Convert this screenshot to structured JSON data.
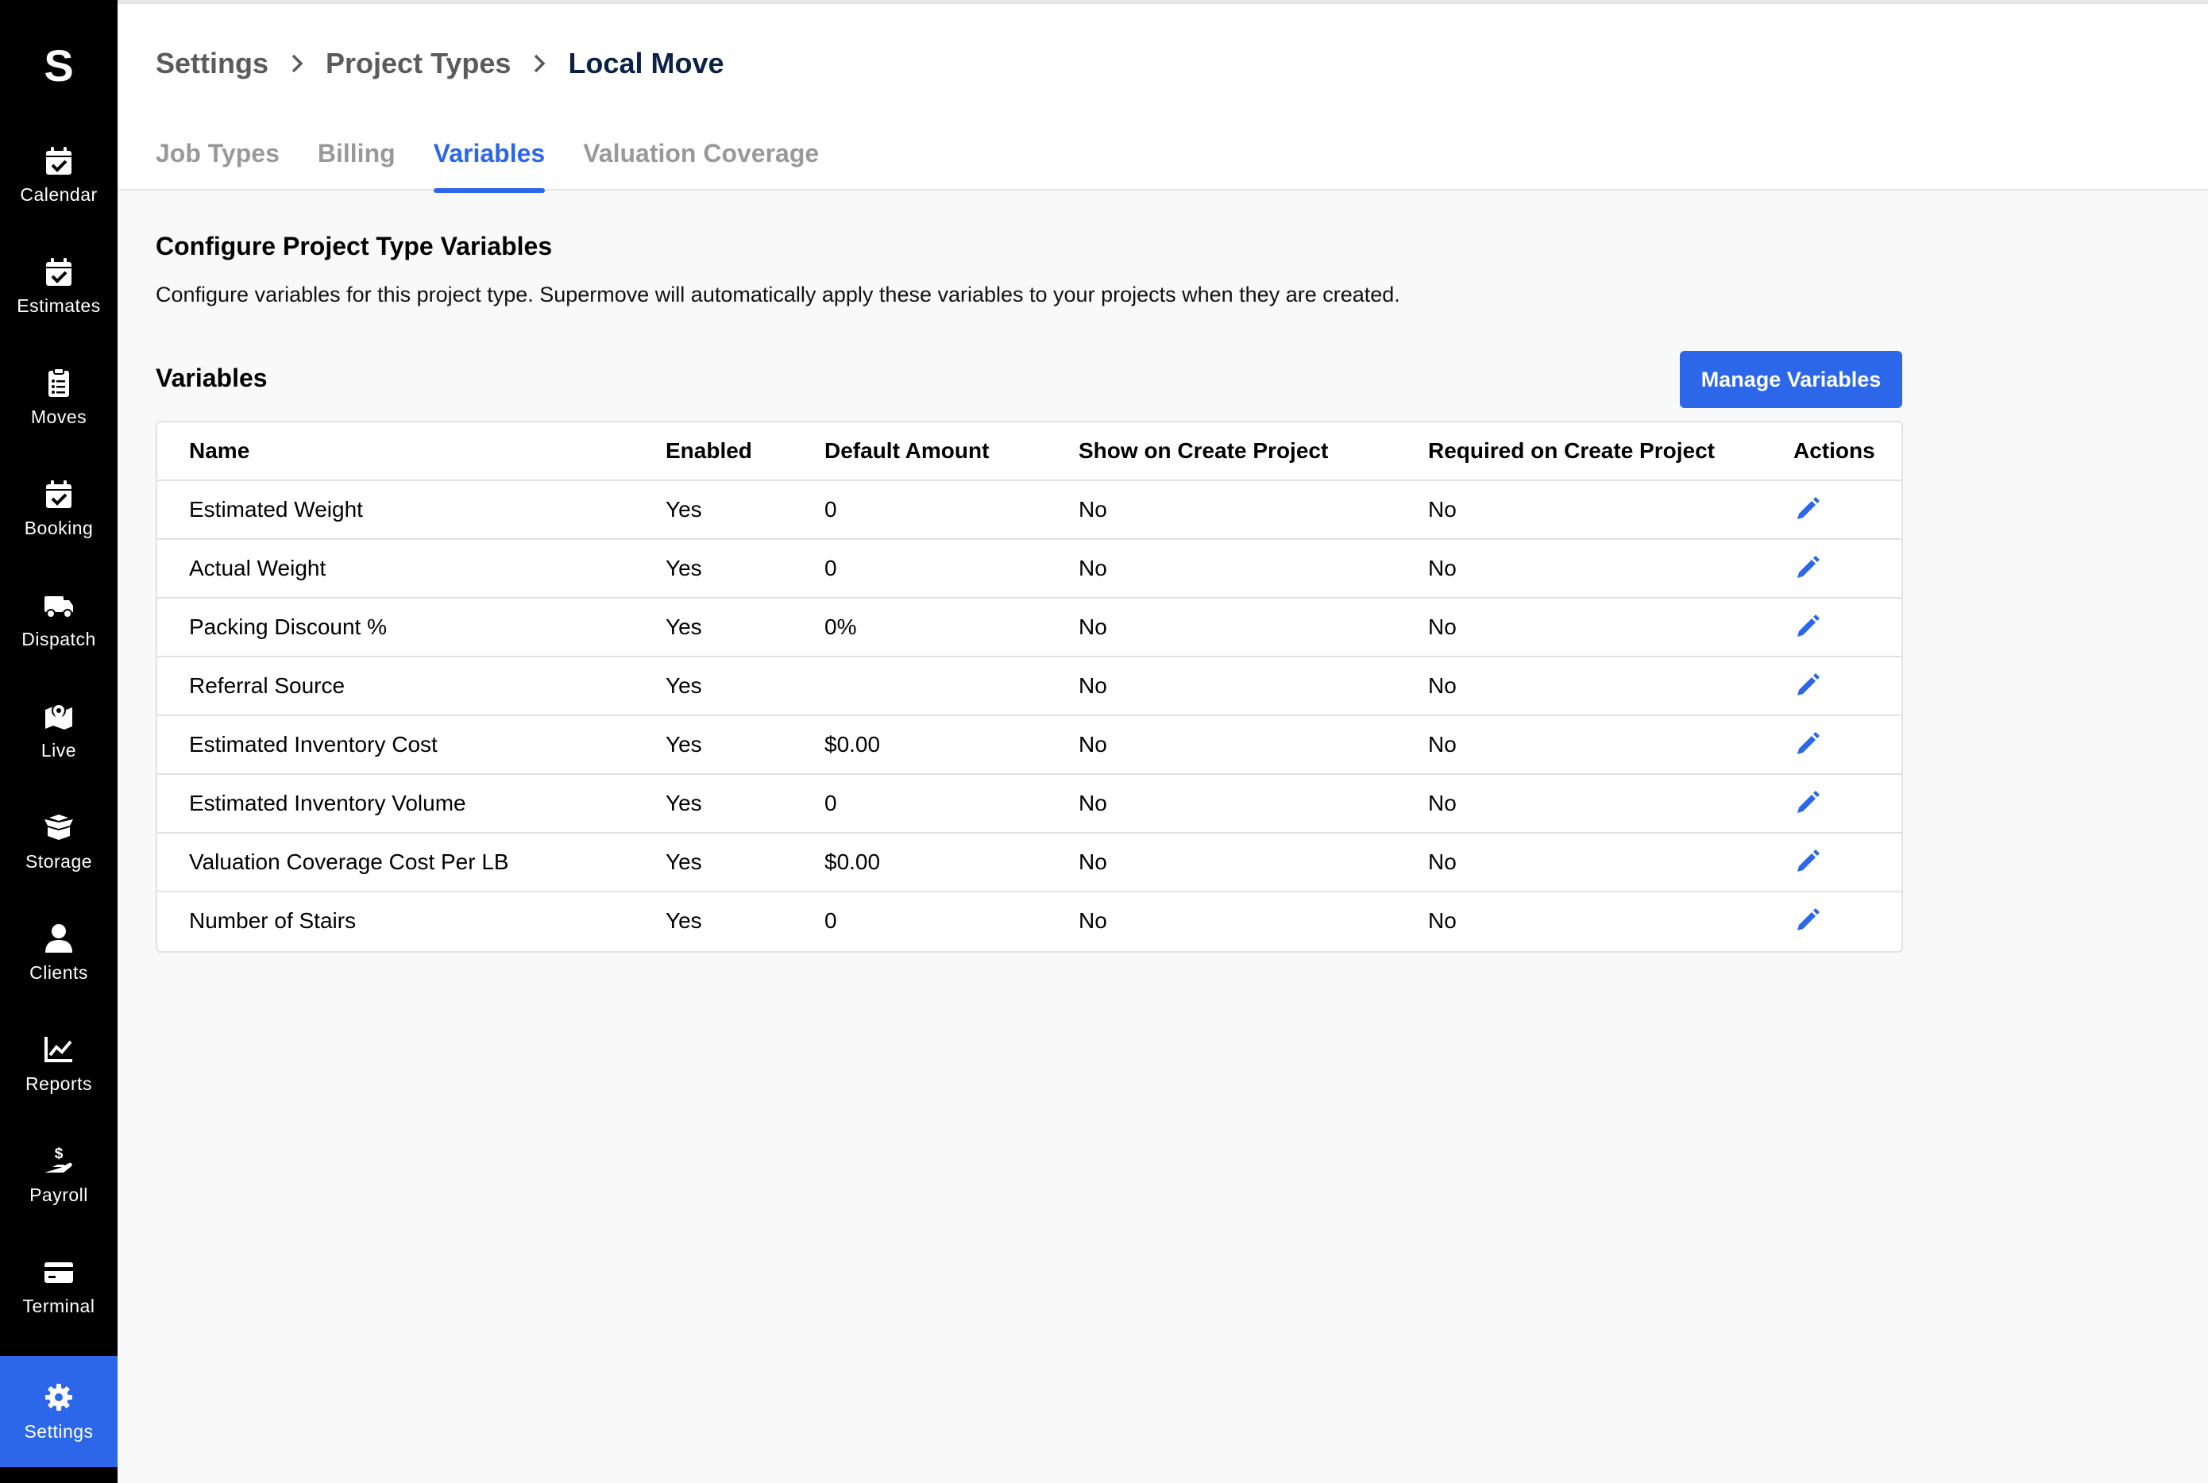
{
  "sidebar": {
    "logo": "S",
    "items": [
      {
        "label": "Calendar",
        "icon": "calendar-check-icon"
      },
      {
        "label": "Estimates",
        "icon": "calendar-check-icon"
      },
      {
        "label": "Moves",
        "icon": "clipboard-list-icon"
      },
      {
        "label": "Booking",
        "icon": "calendar-check-icon"
      },
      {
        "label": "Dispatch",
        "icon": "truck-icon"
      },
      {
        "label": "Live",
        "icon": "map-marker-icon"
      },
      {
        "label": "Storage",
        "icon": "box-open-icon"
      },
      {
        "label": "Clients",
        "icon": "user-icon"
      },
      {
        "label": "Reports",
        "icon": "chart-line-icon"
      },
      {
        "label": "Payroll",
        "icon": "hand-dollar-icon"
      },
      {
        "label": "Terminal",
        "icon": "credit-card-icon"
      },
      {
        "label": "Settings",
        "icon": "gear-icon",
        "active": true
      }
    ]
  },
  "breadcrumb": {
    "items": [
      "Settings",
      "Project Types",
      "Local Move"
    ]
  },
  "tabs": [
    {
      "label": "Job Types"
    },
    {
      "label": "Billing"
    },
    {
      "label": "Variables",
      "active": true
    },
    {
      "label": "Valuation Coverage"
    }
  ],
  "main": {
    "title": "Configure Project Type Variables",
    "description": "Configure variables for this project type. Supermove will automatically apply these variables to your projects when they are created.",
    "variables_title": "Variables",
    "manage_button": "Manage Variables"
  },
  "table": {
    "headers": [
      "Name",
      "Enabled",
      "Default Amount",
      "Show on Create Project",
      "Required on Create Project",
      "Actions"
    ],
    "rows": [
      {
        "name": "Estimated Weight",
        "enabled": "Yes",
        "default": "0",
        "show": "No",
        "required": "No"
      },
      {
        "name": "Actual Weight",
        "enabled": "Yes",
        "default": "0",
        "show": "No",
        "required": "No"
      },
      {
        "name": "Packing Discount %",
        "enabled": "Yes",
        "default": "0%",
        "show": "No",
        "required": "No"
      },
      {
        "name": "Referral Source",
        "enabled": "Yes",
        "default": "",
        "show": "No",
        "required": "No"
      },
      {
        "name": "Estimated Inventory Cost",
        "enabled": "Yes",
        "default": "$0.00",
        "show": "No",
        "required": "No"
      },
      {
        "name": "Estimated Inventory Volume",
        "enabled": "Yes",
        "default": "0",
        "show": "No",
        "required": "No"
      },
      {
        "name": "Valuation Coverage Cost Per LB",
        "enabled": "Yes",
        "default": "$0.00",
        "show": "No",
        "required": "No"
      },
      {
        "name": "Number of Stairs",
        "enabled": "Yes",
        "default": "0",
        "show": "No",
        "required": "No"
      }
    ]
  },
  "colors": {
    "accent": "#2b67e8",
    "sidebar_bg": "#000000",
    "breadcrumb_current": "#0b2248"
  }
}
